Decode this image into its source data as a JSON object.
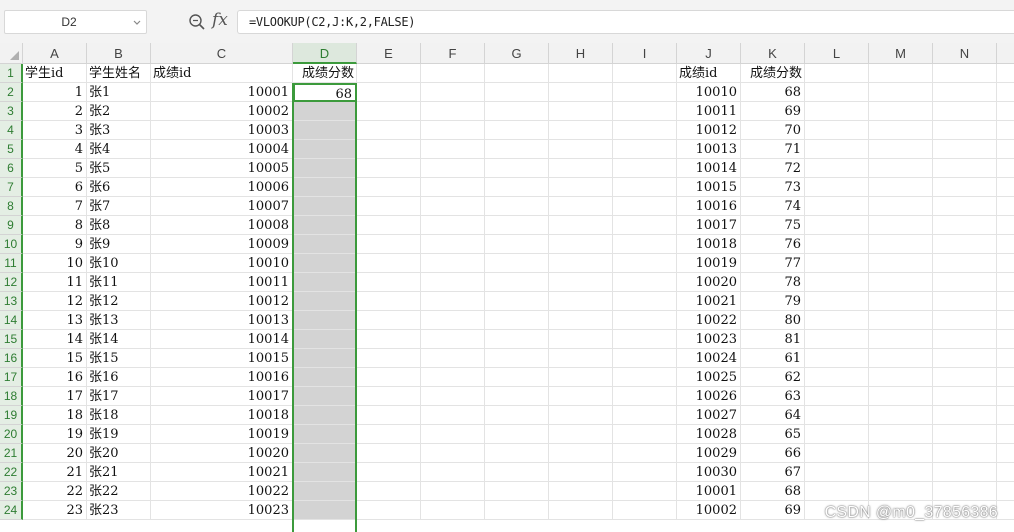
{
  "formula_bar": {
    "name_box": "D2",
    "fx_label": "fx",
    "formula": "=VLOOKUP(C2,J:K,2,FALSE)"
  },
  "columns": [
    "A",
    "B",
    "C",
    "D",
    "E",
    "F",
    "G",
    "H",
    "I",
    "J",
    "K",
    "L",
    "M",
    "N"
  ],
  "selected_column": "D",
  "active_cell": "D2",
  "rows": [
    {
      "n": "1",
      "A": "学生id",
      "B": "学生姓名",
      "C": "成绩id",
      "D": "成绩分数",
      "J": "成绩id",
      "K": "成绩分数"
    },
    {
      "n": "2",
      "A": "1",
      "B": "张1",
      "C": "10001",
      "D": "68",
      "J": "10010",
      "K": "68"
    },
    {
      "n": "3",
      "A": "2",
      "B": "张2",
      "C": "10002",
      "D": "",
      "J": "10011",
      "K": "69"
    },
    {
      "n": "4",
      "A": "3",
      "B": "张3",
      "C": "10003",
      "D": "",
      "J": "10012",
      "K": "70"
    },
    {
      "n": "5",
      "A": "4",
      "B": "张4",
      "C": "10004",
      "D": "",
      "J": "10013",
      "K": "71"
    },
    {
      "n": "6",
      "A": "5",
      "B": "张5",
      "C": "10005",
      "D": "",
      "J": "10014",
      "K": "72"
    },
    {
      "n": "7",
      "A": "6",
      "B": "张6",
      "C": "10006",
      "D": "",
      "J": "10015",
      "K": "73"
    },
    {
      "n": "8",
      "A": "7",
      "B": "张7",
      "C": "10007",
      "D": "",
      "J": "10016",
      "K": "74"
    },
    {
      "n": "9",
      "A": "8",
      "B": "张8",
      "C": "10008",
      "D": "",
      "J": "10017",
      "K": "75"
    },
    {
      "n": "10",
      "A": "9",
      "B": "张9",
      "C": "10009",
      "D": "",
      "J": "10018",
      "K": "76"
    },
    {
      "n": "11",
      "A": "10",
      "B": "张10",
      "C": "10010",
      "D": "",
      "J": "10019",
      "K": "77"
    },
    {
      "n": "12",
      "A": "11",
      "B": "张11",
      "C": "10011",
      "D": "",
      "J": "10020",
      "K": "78"
    },
    {
      "n": "13",
      "A": "12",
      "B": "张12",
      "C": "10012",
      "D": "",
      "J": "10021",
      "K": "79"
    },
    {
      "n": "14",
      "A": "13",
      "B": "张13",
      "C": "10013",
      "D": "",
      "J": "10022",
      "K": "80"
    },
    {
      "n": "15",
      "A": "14",
      "B": "张14",
      "C": "10014",
      "D": "",
      "J": "10023",
      "K": "81"
    },
    {
      "n": "16",
      "A": "15",
      "B": "张15",
      "C": "10015",
      "D": "",
      "J": "10024",
      "K": "61"
    },
    {
      "n": "17",
      "A": "16",
      "B": "张16",
      "C": "10016",
      "D": "",
      "J": "10025",
      "K": "62"
    },
    {
      "n": "18",
      "A": "17",
      "B": "张17",
      "C": "10017",
      "D": "",
      "J": "10026",
      "K": "63"
    },
    {
      "n": "19",
      "A": "18",
      "B": "张18",
      "C": "10018",
      "D": "",
      "J": "10027",
      "K": "64"
    },
    {
      "n": "20",
      "A": "19",
      "B": "张19",
      "C": "10019",
      "D": "",
      "J": "10028",
      "K": "65"
    },
    {
      "n": "21",
      "A": "20",
      "B": "张20",
      "C": "10020",
      "D": "",
      "J": "10029",
      "K": "66"
    },
    {
      "n": "22",
      "A": "21",
      "B": "张21",
      "C": "10021",
      "D": "",
      "J": "10030",
      "K": "67"
    },
    {
      "n": "23",
      "A": "22",
      "B": "张22",
      "C": "10022",
      "D": "",
      "J": "10001",
      "K": "68"
    },
    {
      "n": "24",
      "A": "23",
      "B": "张23",
      "C": "10023",
      "D": "",
      "J": "10002",
      "K": "69"
    }
  ],
  "watermark": "CSDN @m0_37856386",
  "colors": {
    "selection_green": "#3c9a3c",
    "selected_range_fill": "#d3d3d3",
    "header_bg": "#f2f2f2"
  }
}
